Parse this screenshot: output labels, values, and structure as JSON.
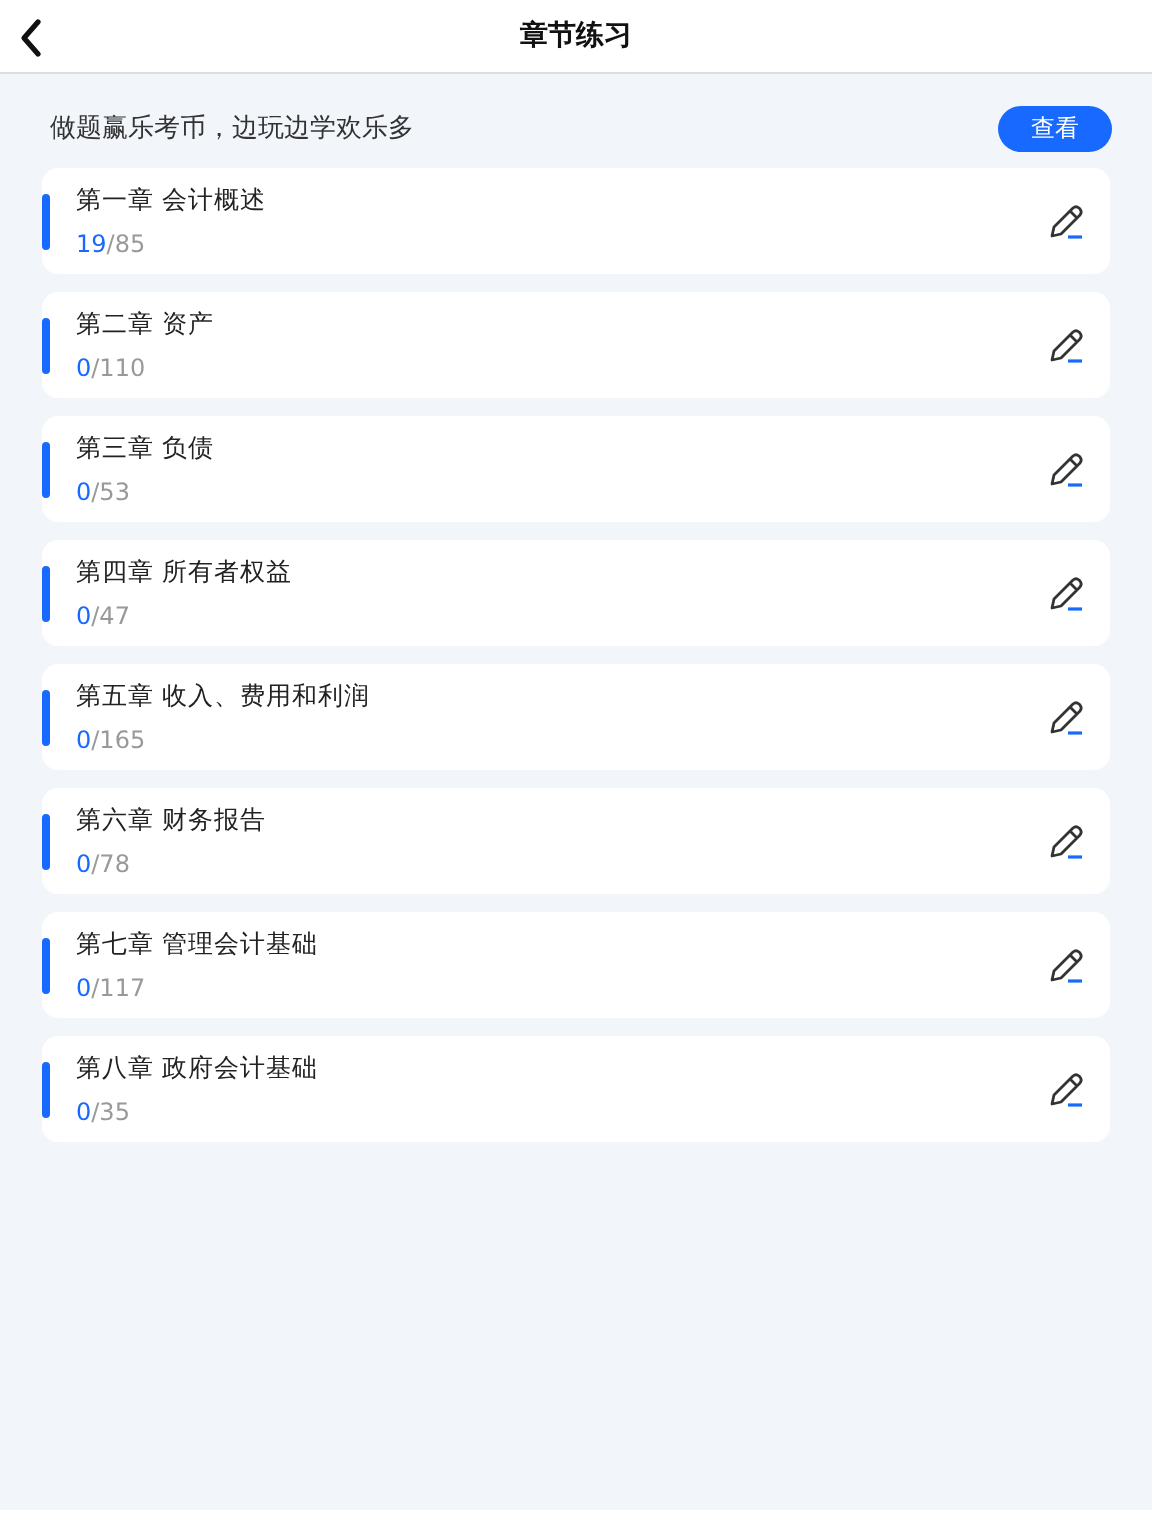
{
  "header": {
    "title": "章节练习"
  },
  "banner": {
    "text": "做题赢乐考币，边玩边学欢乐多",
    "button": "查看"
  },
  "chapters": [
    {
      "title": "第一章 会计概述",
      "done": "19",
      "total": "/85"
    },
    {
      "title": "第二章 资产",
      "done": "0",
      "total": "/110"
    },
    {
      "title": "第三章 负债",
      "done": "0",
      "total": "/53"
    },
    {
      "title": "第四章 所有者权益",
      "done": "0",
      "total": "/47"
    },
    {
      "title": "第五章 收入、费用和利润",
      "done": "0",
      "total": "/165"
    },
    {
      "title": "第六章 财务报告",
      "done": "0",
      "total": "/78"
    },
    {
      "title": "第七章 管理会计基础",
      "done": "0",
      "total": "/117"
    },
    {
      "title": "第八章 政府会计基础",
      "done": "0",
      "total": "/35"
    }
  ]
}
